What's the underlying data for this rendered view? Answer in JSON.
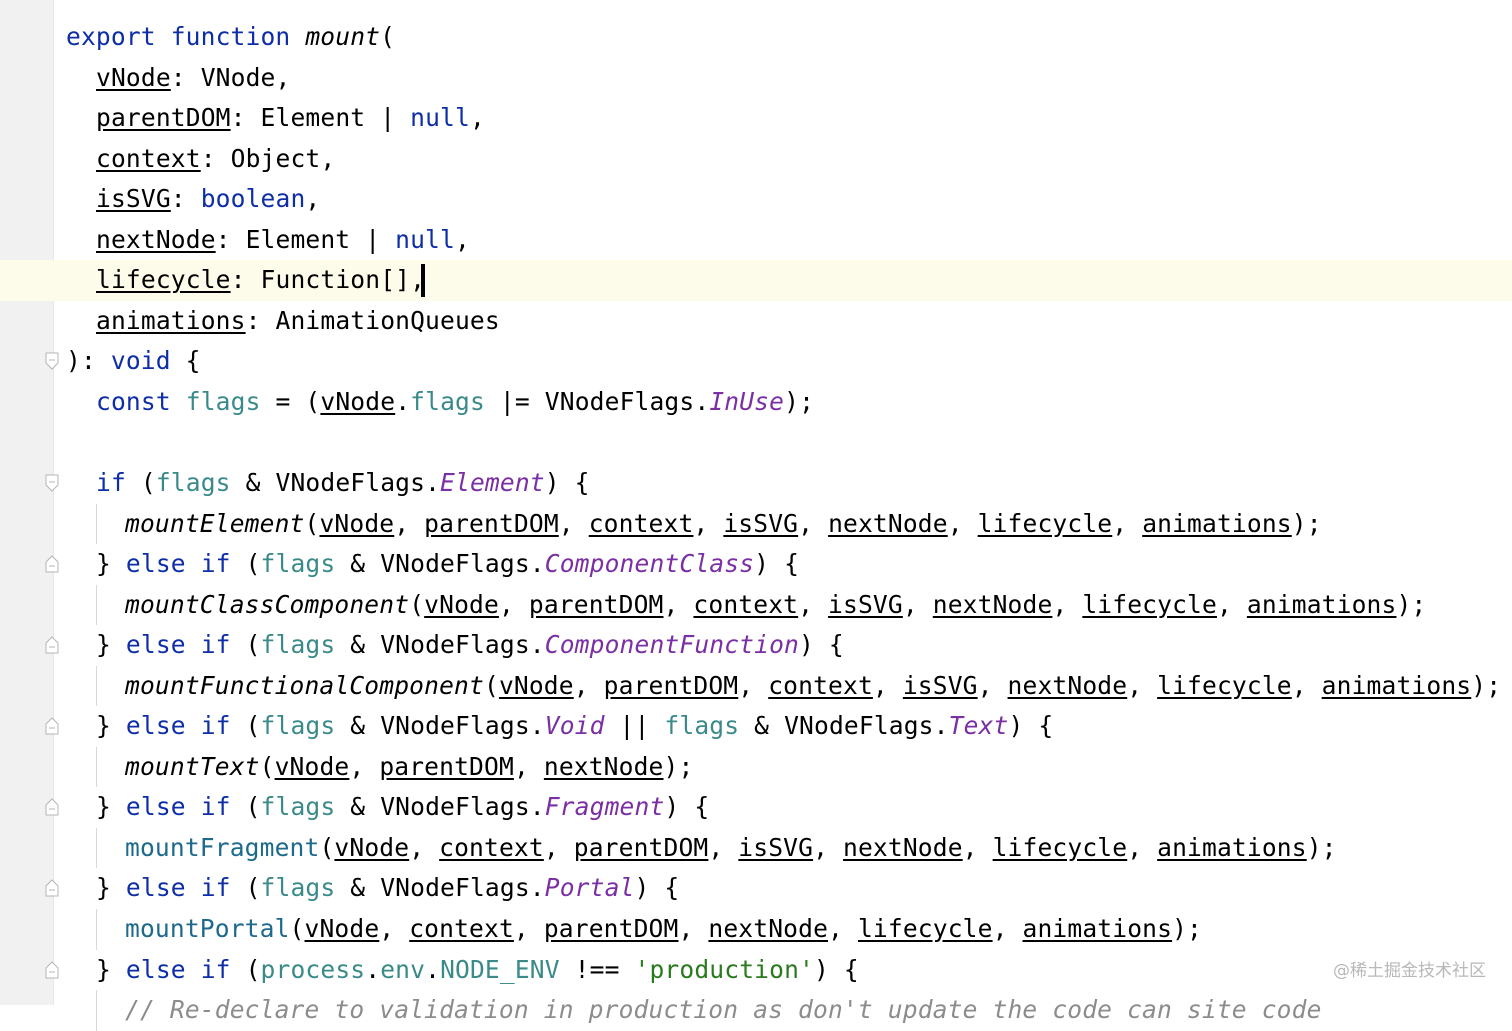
{
  "editor": {
    "lines": [
      [
        {
          "t": "export",
          "c": "kw"
        },
        {
          "t": " "
        },
        {
          "t": "function",
          "c": "kw"
        },
        {
          "t": " "
        },
        {
          "t": "mount",
          "c": "ital"
        },
        {
          "t": "("
        }
      ],
      [
        {
          "t": "vNode",
          "c": "prm"
        },
        {
          "t": ": VNode,"
        }
      ],
      [
        {
          "t": "parentDOM",
          "c": "prm"
        },
        {
          "t": ": Element | "
        },
        {
          "t": "null",
          "c": "kw"
        },
        {
          "t": ","
        }
      ],
      [
        {
          "t": "context",
          "c": "prm"
        },
        {
          "t": ": Object,"
        }
      ],
      [
        {
          "t": "isSVG",
          "c": "prm"
        },
        {
          "t": ": "
        },
        {
          "t": "boolean",
          "c": "kw"
        },
        {
          "t": ","
        }
      ],
      [
        {
          "t": "nextNode",
          "c": "prm"
        },
        {
          "t": ": Element | "
        },
        {
          "t": "null",
          "c": "kw"
        },
        {
          "t": ","
        }
      ],
      [
        {
          "t": "lifecycle",
          "c": "prm"
        },
        {
          "t": ": Function[],"
        }
      ],
      [
        {
          "t": "animations",
          "c": "prm"
        },
        {
          "t": ": AnimationQueues"
        }
      ],
      [
        {
          "t": "): "
        },
        {
          "t": "void",
          "c": "kw"
        },
        {
          "t": " {"
        }
      ],
      [
        {
          "t": "const",
          "c": "kw"
        },
        {
          "t": " "
        },
        {
          "t": "flags",
          "c": "fld"
        },
        {
          "t": " = ("
        },
        {
          "t": "vNode",
          "c": "prm"
        },
        {
          "t": "."
        },
        {
          "t": "flags",
          "c": "fld"
        },
        {
          "t": " |= VNodeFlags."
        },
        {
          "t": "InUse",
          "c": "cst"
        },
        {
          "t": ");"
        }
      ],
      [],
      [
        {
          "t": "if",
          "c": "kw"
        },
        {
          "t": " ("
        },
        {
          "t": "flags",
          "c": "fld"
        },
        {
          "t": " & VNodeFlags."
        },
        {
          "t": "Element",
          "c": "cst"
        },
        {
          "t": ") {"
        }
      ],
      [
        {
          "t": "mountElement",
          "c": "ital"
        },
        {
          "t": "("
        },
        {
          "t": "vNode",
          "c": "prm"
        },
        {
          "t": ", "
        },
        {
          "t": "parentDOM",
          "c": "prm"
        },
        {
          "t": ", "
        },
        {
          "t": "context",
          "c": "prm"
        },
        {
          "t": ", "
        },
        {
          "t": "isSVG",
          "c": "prm"
        },
        {
          "t": ", "
        },
        {
          "t": "nextNode",
          "c": "prm"
        },
        {
          "t": ", "
        },
        {
          "t": "lifecycle",
          "c": "prm"
        },
        {
          "t": ", "
        },
        {
          "t": "animations",
          "c": "prm"
        },
        {
          "t": ");"
        }
      ],
      [
        {
          "t": "} "
        },
        {
          "t": "else if",
          "c": "kw"
        },
        {
          "t": " ("
        },
        {
          "t": "flags",
          "c": "fld"
        },
        {
          "t": " & VNodeFlags."
        },
        {
          "t": "ComponentClass",
          "c": "cst"
        },
        {
          "t": ") {"
        }
      ],
      [
        {
          "t": "mountClassComponent",
          "c": "ital"
        },
        {
          "t": "("
        },
        {
          "t": "vNode",
          "c": "prm"
        },
        {
          "t": ", "
        },
        {
          "t": "parentDOM",
          "c": "prm"
        },
        {
          "t": ", "
        },
        {
          "t": "context",
          "c": "prm"
        },
        {
          "t": ", "
        },
        {
          "t": "isSVG",
          "c": "prm"
        },
        {
          "t": ", "
        },
        {
          "t": "nextNode",
          "c": "prm"
        },
        {
          "t": ", "
        },
        {
          "t": "lifecycle",
          "c": "prm"
        },
        {
          "t": ", "
        },
        {
          "t": "animations",
          "c": "prm"
        },
        {
          "t": ");"
        }
      ],
      [
        {
          "t": "} "
        },
        {
          "t": "else if",
          "c": "kw"
        },
        {
          "t": " ("
        },
        {
          "t": "flags",
          "c": "fld"
        },
        {
          "t": " & VNodeFlags."
        },
        {
          "t": "ComponentFunction",
          "c": "cst"
        },
        {
          "t": ") {"
        }
      ],
      [
        {
          "t": "mountFunctionalComponent",
          "c": "ital"
        },
        {
          "t": "("
        },
        {
          "t": "vNode",
          "c": "prm"
        },
        {
          "t": ", "
        },
        {
          "t": "parentDOM",
          "c": "prm"
        },
        {
          "t": ", "
        },
        {
          "t": "context",
          "c": "prm"
        },
        {
          "t": ", "
        },
        {
          "t": "isSVG",
          "c": "prm"
        },
        {
          "t": ", "
        },
        {
          "t": "nextNode",
          "c": "prm"
        },
        {
          "t": ", "
        },
        {
          "t": "lifecycle",
          "c": "prm"
        },
        {
          "t": ", "
        },
        {
          "t": "animations",
          "c": "prm"
        },
        {
          "t": ");"
        }
      ],
      [
        {
          "t": "} "
        },
        {
          "t": "else if",
          "c": "kw"
        },
        {
          "t": " ("
        },
        {
          "t": "flags",
          "c": "fld"
        },
        {
          "t": " & VNodeFlags."
        },
        {
          "t": "Void",
          "c": "cst"
        },
        {
          "t": " || "
        },
        {
          "t": "flags",
          "c": "fld"
        },
        {
          "t": " & VNodeFlags."
        },
        {
          "t": "Text",
          "c": "cst"
        },
        {
          "t": ") {"
        }
      ],
      [
        {
          "t": "mountText",
          "c": "ital"
        },
        {
          "t": "("
        },
        {
          "t": "vNode",
          "c": "prm"
        },
        {
          "t": ", "
        },
        {
          "t": "parentDOM",
          "c": "prm"
        },
        {
          "t": ", "
        },
        {
          "t": "nextNode",
          "c": "prm"
        },
        {
          "t": ");"
        }
      ],
      [
        {
          "t": "} "
        },
        {
          "t": "else if",
          "c": "kw"
        },
        {
          "t": " ("
        },
        {
          "t": "flags",
          "c": "fld"
        },
        {
          "t": " & VNodeFlags."
        },
        {
          "t": "Fragment",
          "c": "cst"
        },
        {
          "t": ") {"
        }
      ],
      [
        {
          "t": "mountFragment",
          "c": "fnb"
        },
        {
          "t": "("
        },
        {
          "t": "vNode",
          "c": "prm"
        },
        {
          "t": ", "
        },
        {
          "t": "context",
          "c": "prm"
        },
        {
          "t": ", "
        },
        {
          "t": "parentDOM",
          "c": "prm"
        },
        {
          "t": ", "
        },
        {
          "t": "isSVG",
          "c": "prm"
        },
        {
          "t": ", "
        },
        {
          "t": "nextNode",
          "c": "prm"
        },
        {
          "t": ", "
        },
        {
          "t": "lifecycle",
          "c": "prm"
        },
        {
          "t": ", "
        },
        {
          "t": "animations",
          "c": "prm"
        },
        {
          "t": ");"
        }
      ],
      [
        {
          "t": "} "
        },
        {
          "t": "else if",
          "c": "kw"
        },
        {
          "t": " ("
        },
        {
          "t": "flags",
          "c": "fld"
        },
        {
          "t": " & VNodeFlags."
        },
        {
          "t": "Portal",
          "c": "cst"
        },
        {
          "t": ") {"
        }
      ],
      [
        {
          "t": "mountPortal",
          "c": "fnb"
        },
        {
          "t": "("
        },
        {
          "t": "vNode",
          "c": "prm"
        },
        {
          "t": ", "
        },
        {
          "t": "context",
          "c": "prm"
        },
        {
          "t": ", "
        },
        {
          "t": "parentDOM",
          "c": "prm"
        },
        {
          "t": ", "
        },
        {
          "t": "nextNode",
          "c": "prm"
        },
        {
          "t": ", "
        },
        {
          "t": "lifecycle",
          "c": "prm"
        },
        {
          "t": ", "
        },
        {
          "t": "animations",
          "c": "prm"
        },
        {
          "t": ");"
        }
      ],
      [
        {
          "t": "} "
        },
        {
          "t": "else if",
          "c": "kw"
        },
        {
          "t": " ("
        },
        {
          "t": "process",
          "c": "fld"
        },
        {
          "t": "."
        },
        {
          "t": "env",
          "c": "fld"
        },
        {
          "t": "."
        },
        {
          "t": "NODE_ENV",
          "c": "fld"
        },
        {
          "t": " !== "
        },
        {
          "t": "'production'",
          "c": "str"
        },
        {
          "t": ") {"
        }
      ],
      [
        {
          "t": "// Re-declare to validation in production as don't update the code can site code",
          "c": "cmt"
        }
      ]
    ]
  },
  "watermark": "@稀土掘金技术社区"
}
